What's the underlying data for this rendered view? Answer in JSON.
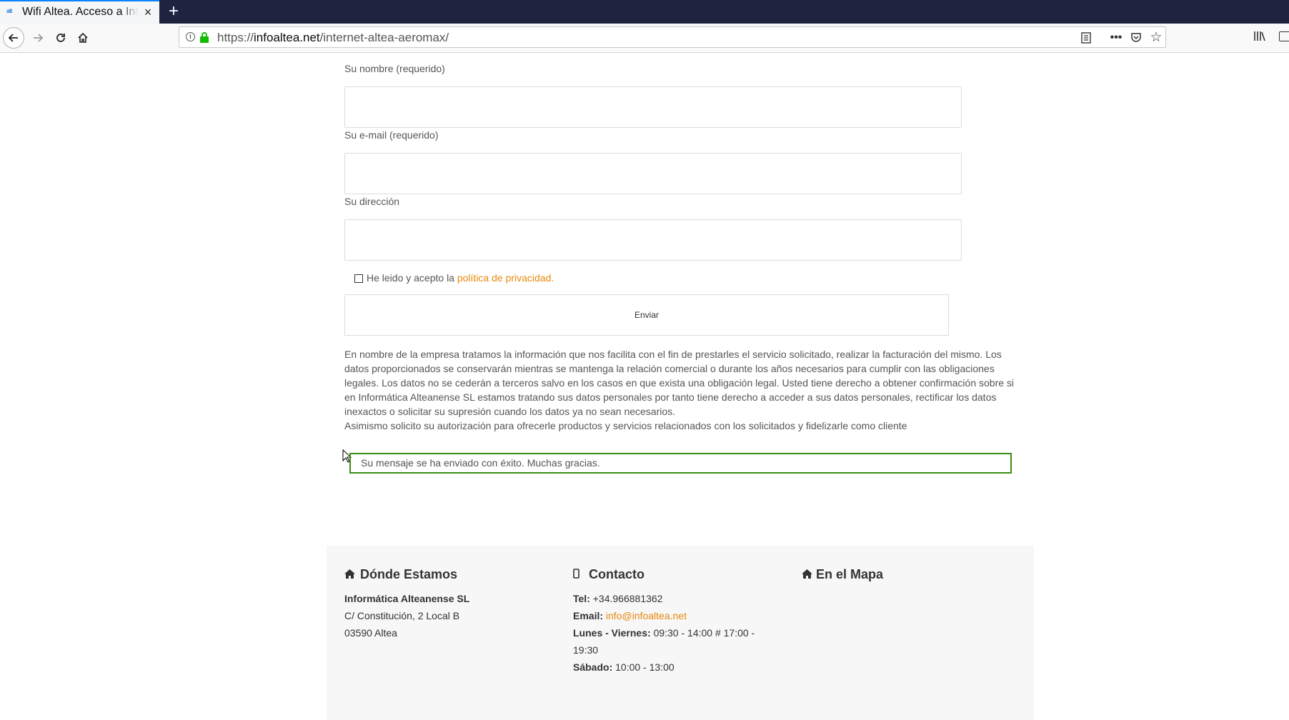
{
  "browser": {
    "tab_favicon": "alt",
    "tab_title": "Wifi Altea. Acceso a Internet",
    "tab_close": "×",
    "new_tab": "+",
    "url_scheme": "https://",
    "url_domain": "infoaltea.net",
    "url_path": "/internet-altea-aeromax/"
  },
  "form": {
    "name_label": "Su nombre (requerido)",
    "email_label": "Su e-mail (requerido)",
    "address_label": "Su dirección",
    "name_value": "",
    "email_value": "",
    "address_value": "",
    "consent_text": "He leido y acepto la",
    "consent_link": "política de privacidad.",
    "consent_checked": false,
    "submit_label": "Enviar"
  },
  "privacy_notice": {
    "paragraph": "En nombre de la empresa tratamos la información que nos facilita con el fin de prestarles el servicio solicitado, realizar la facturación del mismo. Los datos proporcionados se conservarán mientras se mantenga la relación comercial o durante los años necesarios para cumplir con las obligaciones legales. Los datos no se cederán a terceros salvo en los casos en que exista una obligación legal. Usted tiene derecho a obtener confirmación sobre si en Informática Alteanense SL estamos tratando sus datos personales por tanto tiene derecho a acceder a sus datos personales, rectificar los datos inexactos o solicitar su supresión cuando los datos ya no sean necesarios.",
    "consent_line": "Asimismo solicito su autorización para ofrecerle productos y servicios relacionados con los solicitados y fidelizarle como cliente"
  },
  "status": {
    "success_message": "Su mensaje se ha enviado con éxito. Muchas gracias.",
    "success_color": "#398f14"
  },
  "footer": {
    "where": {
      "title": "Dónde Estamos",
      "icon": "home-icon",
      "company": "Informática Alteanense SL",
      "street": "C/ Constitución, 2 Local B",
      "city": "03590 Altea"
    },
    "contact": {
      "title": "Contacto",
      "icon": "mobile-icon",
      "tel_label": "Tel:",
      "tel_value": "+34.966881362",
      "email_label": "Email:",
      "email_value": "info@infoaltea.net",
      "weekday_label": "Lunes - Viernes:",
      "weekday_hours_a": "09:30 - 14:00 # 17:00 -",
      "weekday_hours_b": "19:30",
      "saturday_label": "Sábado:",
      "saturday_hours": "10:00 - 13:00"
    },
    "map": {
      "title": "En el Mapa",
      "icon": "home-icon"
    }
  },
  "colors": {
    "link_accent": "#e8890c",
    "tabbar_bg": "#202340",
    "footer_bg": "#f7f7f7"
  }
}
